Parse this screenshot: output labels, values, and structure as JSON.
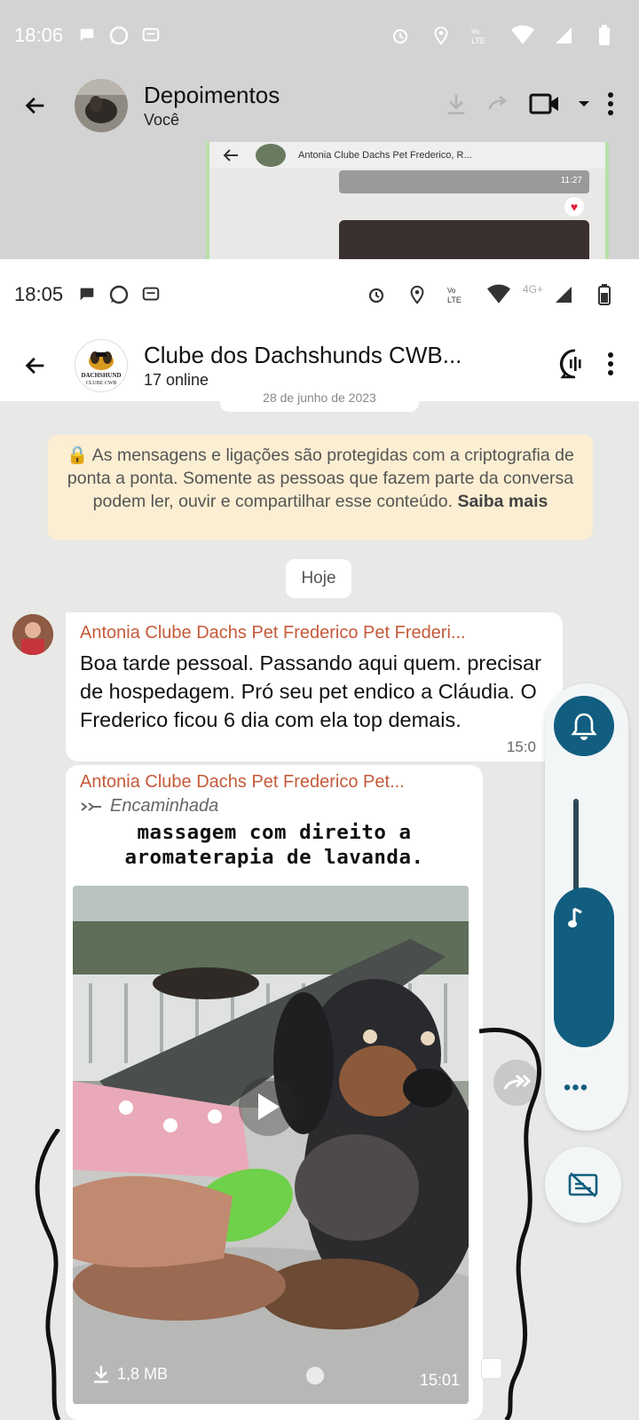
{
  "top_screen": {
    "status": {
      "time": "18:06"
    },
    "header": {
      "title": "Depoimentos",
      "subtitle": "Você"
    },
    "nested": {
      "contact": "Antonia Clube Dachs Pet Frederico, R...",
      "time": "11:27"
    }
  },
  "main_screen": {
    "status": {
      "time": "18:05",
      "network": "4G+"
    },
    "header": {
      "title": "Clube dos Dachshunds CWB...",
      "subtitle": "17 online",
      "avatar_text": "DACHSHUND CLUBE CWB"
    },
    "date_chip": "28 de junho de 2023",
    "encryption_notice": {
      "text": "🔒 As mensagens e ligações são protegidas com a criptografia de ponta a ponta. Somente as pessoas que fazem parte da conversa podem ler, ouvir e compartilhar esse conteúdo.",
      "link": "Saiba mais"
    },
    "today_label": "Hoje",
    "messages": [
      {
        "sender": "Antonia Clube Dachs Pet Frederico Pet Frederi...",
        "text": "Boa tarde pessoal.  Passando aqui quem. precisar de hospedagem. Pró seu pet endico a Cláudia. O Frederico ficou 6 dia com ela  top demais.",
        "time": "15:0"
      },
      {
        "sender": "Antonia Clube Dachs Pet Frederico Pet...",
        "forwarded_label": "Encaminhada",
        "caption_line1": "massagem com direito a",
        "caption_line2": "aromaterapia de lavanda.",
        "video_size": "1,8 MB",
        "time": "15:01"
      }
    ]
  },
  "colors": {
    "accent": "#125e80",
    "sender_name": "#c55a39",
    "encryption_bg": "#fbeed2"
  }
}
